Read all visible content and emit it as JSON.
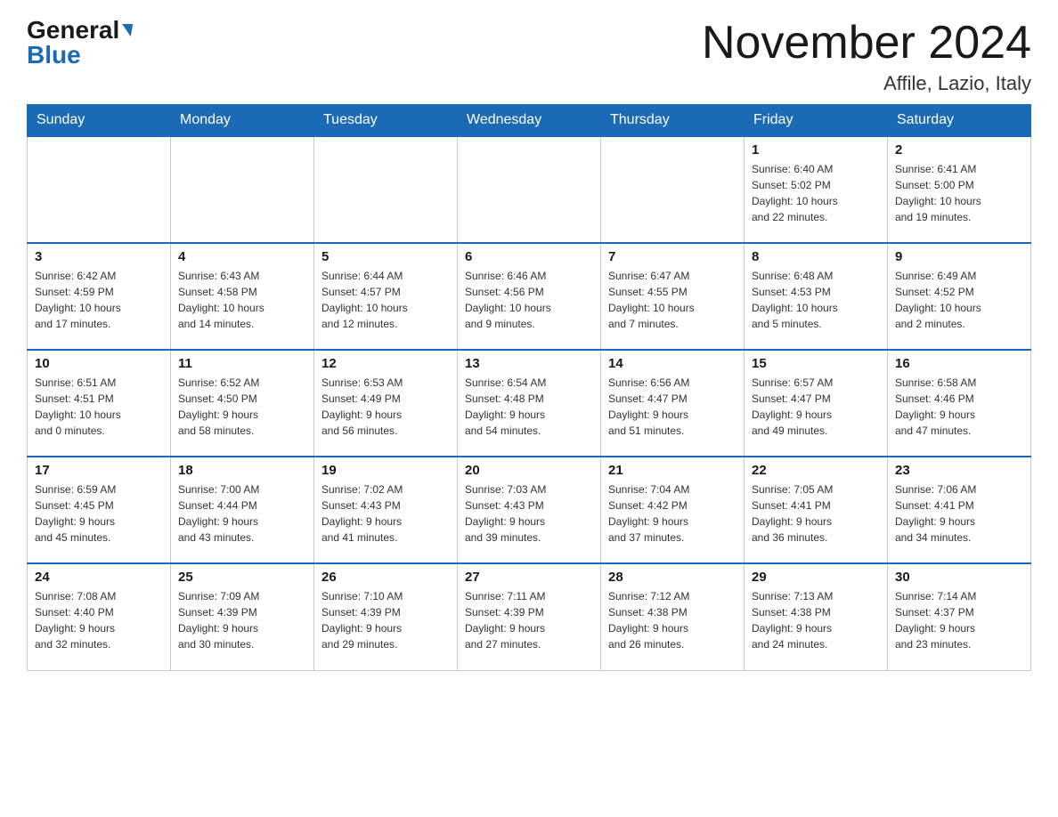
{
  "header": {
    "logo_general": "General",
    "logo_blue": "Blue",
    "month_title": "November 2024",
    "location": "Affile, Lazio, Italy"
  },
  "weekdays": [
    "Sunday",
    "Monday",
    "Tuesday",
    "Wednesday",
    "Thursday",
    "Friday",
    "Saturday"
  ],
  "weeks": [
    [
      {
        "day": "",
        "info": ""
      },
      {
        "day": "",
        "info": ""
      },
      {
        "day": "",
        "info": ""
      },
      {
        "day": "",
        "info": ""
      },
      {
        "day": "",
        "info": ""
      },
      {
        "day": "1",
        "info": "Sunrise: 6:40 AM\nSunset: 5:02 PM\nDaylight: 10 hours\nand 22 minutes."
      },
      {
        "day": "2",
        "info": "Sunrise: 6:41 AM\nSunset: 5:00 PM\nDaylight: 10 hours\nand 19 minutes."
      }
    ],
    [
      {
        "day": "3",
        "info": "Sunrise: 6:42 AM\nSunset: 4:59 PM\nDaylight: 10 hours\nand 17 minutes."
      },
      {
        "day": "4",
        "info": "Sunrise: 6:43 AM\nSunset: 4:58 PM\nDaylight: 10 hours\nand 14 minutes."
      },
      {
        "day": "5",
        "info": "Sunrise: 6:44 AM\nSunset: 4:57 PM\nDaylight: 10 hours\nand 12 minutes."
      },
      {
        "day": "6",
        "info": "Sunrise: 6:46 AM\nSunset: 4:56 PM\nDaylight: 10 hours\nand 9 minutes."
      },
      {
        "day": "7",
        "info": "Sunrise: 6:47 AM\nSunset: 4:55 PM\nDaylight: 10 hours\nand 7 minutes."
      },
      {
        "day": "8",
        "info": "Sunrise: 6:48 AM\nSunset: 4:53 PM\nDaylight: 10 hours\nand 5 minutes."
      },
      {
        "day": "9",
        "info": "Sunrise: 6:49 AM\nSunset: 4:52 PM\nDaylight: 10 hours\nand 2 minutes."
      }
    ],
    [
      {
        "day": "10",
        "info": "Sunrise: 6:51 AM\nSunset: 4:51 PM\nDaylight: 10 hours\nand 0 minutes."
      },
      {
        "day": "11",
        "info": "Sunrise: 6:52 AM\nSunset: 4:50 PM\nDaylight: 9 hours\nand 58 minutes."
      },
      {
        "day": "12",
        "info": "Sunrise: 6:53 AM\nSunset: 4:49 PM\nDaylight: 9 hours\nand 56 minutes."
      },
      {
        "day": "13",
        "info": "Sunrise: 6:54 AM\nSunset: 4:48 PM\nDaylight: 9 hours\nand 54 minutes."
      },
      {
        "day": "14",
        "info": "Sunrise: 6:56 AM\nSunset: 4:47 PM\nDaylight: 9 hours\nand 51 minutes."
      },
      {
        "day": "15",
        "info": "Sunrise: 6:57 AM\nSunset: 4:47 PM\nDaylight: 9 hours\nand 49 minutes."
      },
      {
        "day": "16",
        "info": "Sunrise: 6:58 AM\nSunset: 4:46 PM\nDaylight: 9 hours\nand 47 minutes."
      }
    ],
    [
      {
        "day": "17",
        "info": "Sunrise: 6:59 AM\nSunset: 4:45 PM\nDaylight: 9 hours\nand 45 minutes."
      },
      {
        "day": "18",
        "info": "Sunrise: 7:00 AM\nSunset: 4:44 PM\nDaylight: 9 hours\nand 43 minutes."
      },
      {
        "day": "19",
        "info": "Sunrise: 7:02 AM\nSunset: 4:43 PM\nDaylight: 9 hours\nand 41 minutes."
      },
      {
        "day": "20",
        "info": "Sunrise: 7:03 AM\nSunset: 4:43 PM\nDaylight: 9 hours\nand 39 minutes."
      },
      {
        "day": "21",
        "info": "Sunrise: 7:04 AM\nSunset: 4:42 PM\nDaylight: 9 hours\nand 37 minutes."
      },
      {
        "day": "22",
        "info": "Sunrise: 7:05 AM\nSunset: 4:41 PM\nDaylight: 9 hours\nand 36 minutes."
      },
      {
        "day": "23",
        "info": "Sunrise: 7:06 AM\nSunset: 4:41 PM\nDaylight: 9 hours\nand 34 minutes."
      }
    ],
    [
      {
        "day": "24",
        "info": "Sunrise: 7:08 AM\nSunset: 4:40 PM\nDaylight: 9 hours\nand 32 minutes."
      },
      {
        "day": "25",
        "info": "Sunrise: 7:09 AM\nSunset: 4:39 PM\nDaylight: 9 hours\nand 30 minutes."
      },
      {
        "day": "26",
        "info": "Sunrise: 7:10 AM\nSunset: 4:39 PM\nDaylight: 9 hours\nand 29 minutes."
      },
      {
        "day": "27",
        "info": "Sunrise: 7:11 AM\nSunset: 4:39 PM\nDaylight: 9 hours\nand 27 minutes."
      },
      {
        "day": "28",
        "info": "Sunrise: 7:12 AM\nSunset: 4:38 PM\nDaylight: 9 hours\nand 26 minutes."
      },
      {
        "day": "29",
        "info": "Sunrise: 7:13 AM\nSunset: 4:38 PM\nDaylight: 9 hours\nand 24 minutes."
      },
      {
        "day": "30",
        "info": "Sunrise: 7:14 AM\nSunset: 4:37 PM\nDaylight: 9 hours\nand 23 minutes."
      }
    ]
  ]
}
